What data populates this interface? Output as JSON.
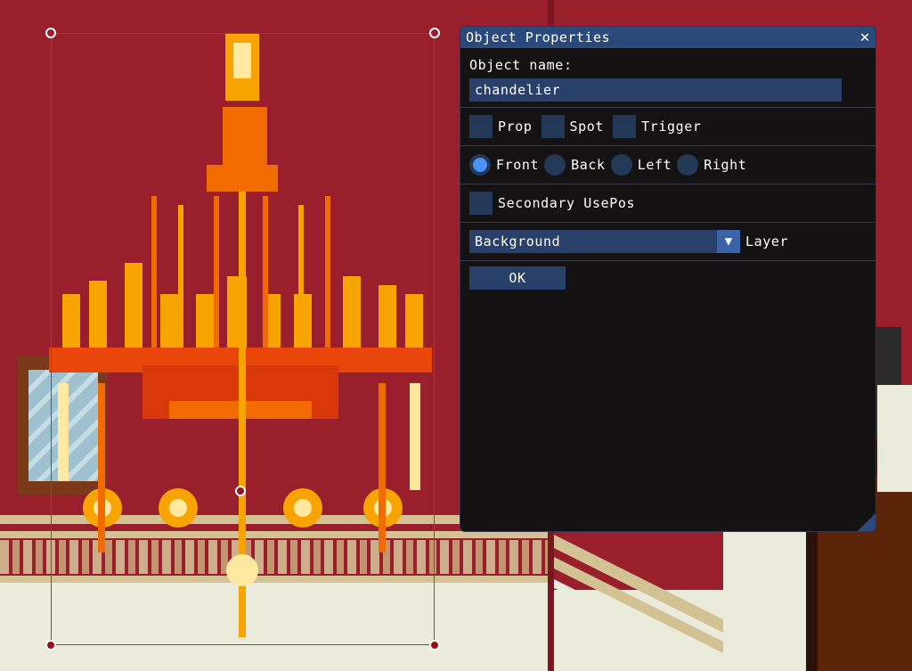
{
  "dialog": {
    "title": "Object Properties",
    "close_glyph": "✕",
    "object_name_label": "Object name:",
    "object_name_value": "chandelier",
    "flags": [
      {
        "label": "Prop",
        "checked": false
      },
      {
        "label": "Spot",
        "checked": false
      },
      {
        "label": "Trigger",
        "checked": false
      }
    ],
    "facing": {
      "options": [
        "Front",
        "Back",
        "Left",
        "Right"
      ],
      "selected": "Front"
    },
    "secondary_usepos": {
      "label": "Secondary UsePos",
      "checked": false
    },
    "layer": {
      "value": "Background",
      "label": "Layer"
    },
    "ok_label": "OK"
  },
  "scene": {
    "selected_object": "chandelier",
    "icons": [
      "close-icon",
      "chevron-down-icon"
    ],
    "colors": {
      "wall": "#9a1f2d",
      "selection": "#e0202a",
      "accent": "#4a94f7",
      "titlebar": "#2a4a7b"
    }
  }
}
